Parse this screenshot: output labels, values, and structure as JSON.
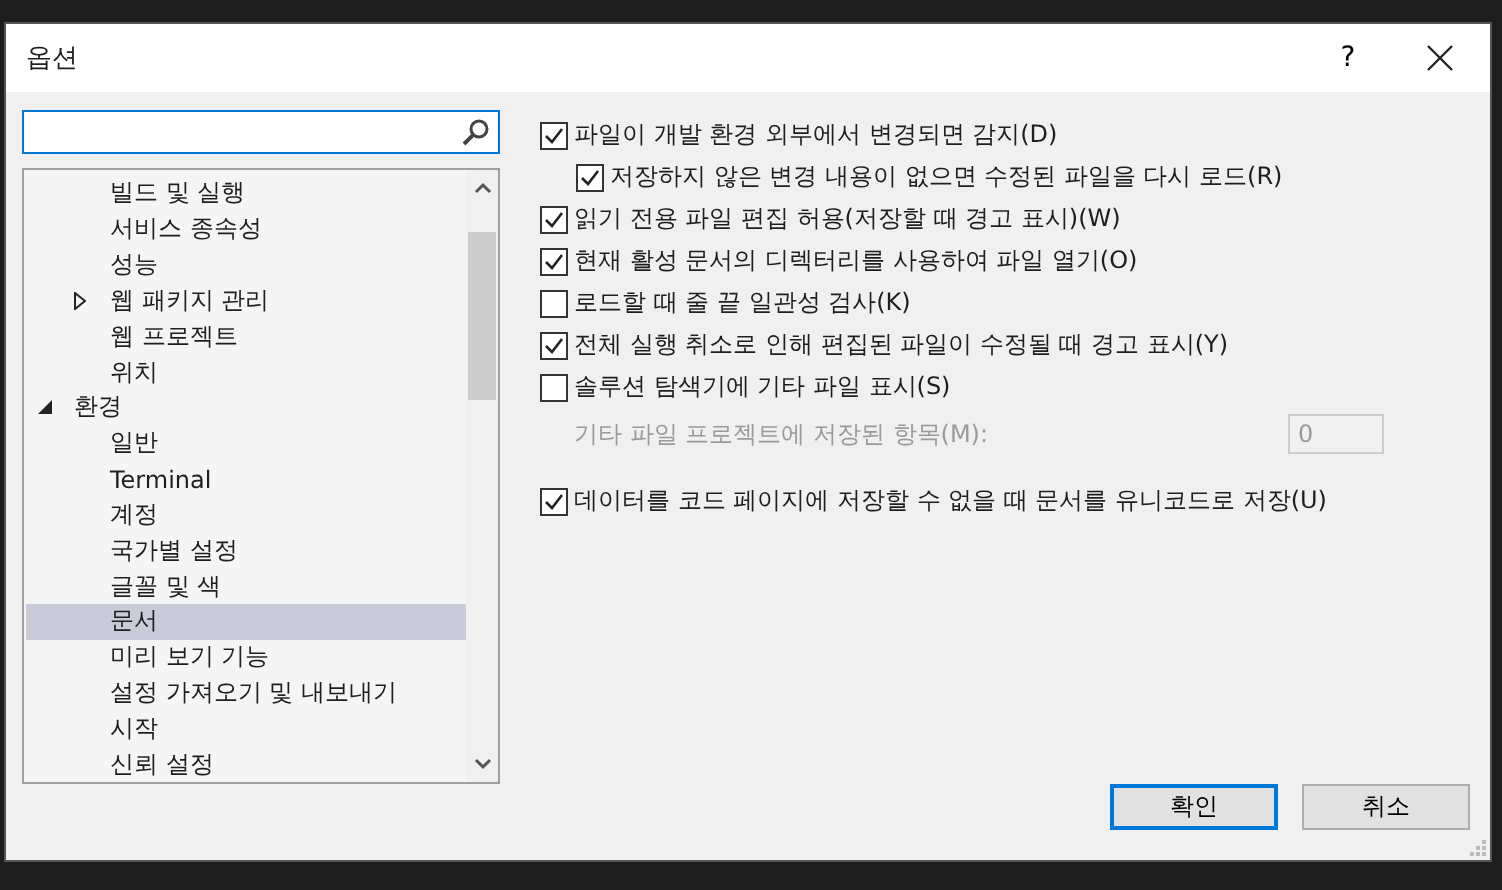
{
  "window": {
    "title": "옵션",
    "help": "?"
  },
  "tree": {
    "continued_items": [
      {
        "label": "빌드 및 실행",
        "selected": false
      },
      {
        "label": "서비스 종속성",
        "selected": false
      },
      {
        "label": "성능",
        "selected": false
      },
      {
        "label": "웹 패키지 관리",
        "selected": false,
        "expanded": false
      },
      {
        "label": "웹 프로젝트",
        "selected": false
      },
      {
        "label": "위치",
        "selected": false
      }
    ],
    "items": [
      {
        "label": "환경",
        "selected": false,
        "expanded": true,
        "children": [
          {
            "label": "일반",
            "selected": false
          },
          {
            "label": "Terminal",
            "selected": false
          },
          {
            "label": "계정",
            "selected": false
          },
          {
            "label": "국가별 설정",
            "selected": false
          },
          {
            "label": "글꼴 및 색",
            "selected": false
          },
          {
            "label": "문서",
            "selected": true
          },
          {
            "label": "미리 보기 기능",
            "selected": false
          },
          {
            "label": "설정 가져오기 및 내보내기",
            "selected": false
          },
          {
            "label": "시작",
            "selected": false
          },
          {
            "label": "신뢰 설정",
            "selected": false
          }
        ]
      }
    ]
  },
  "options": [
    {
      "kind": "checkbox",
      "label": "파일이 개발 환경 외부에서 변경되면 감지(D)",
      "checked": true
    },
    {
      "kind": "subcheckbox",
      "label": "저장하지 않은 변경 내용이 없으면 수정된 파일을 다시 로드(R)",
      "checked": true
    },
    {
      "kind": "checkbox",
      "label": "읽기 전용 파일 편집 허용(저장할 때 경고 표시)(W)",
      "checked": true
    },
    {
      "kind": "checkbox",
      "label": "현재 활성 문서의 디렉터리를 사용하여 파일 열기(O)",
      "checked": true
    },
    {
      "kind": "checkbox",
      "label": "로드할 때 줄 끝 일관성 검사(K)",
      "checked": false
    },
    {
      "kind": "checkbox",
      "label": "전체 실행 취소로 인해 편집된 파일이 수정될 때 경고 표시(Y)",
      "checked": true
    },
    {
      "kind": "checkbox",
      "label": "솔루션 탐색기에 기타 파일 표시(S)",
      "checked": false
    },
    {
      "kind": "number",
      "label": "기타 파일 프로젝트에 저장된 항목(M):",
      "value": "0",
      "disabled": true
    },
    {
      "kind": "checkbox",
      "label": "데이터를 코드 페이지에 저장할 수 없을 때 문서를 유니코드로 저장(U)",
      "checked": true
    }
  ],
  "buttons": [
    {
      "label": "확인",
      "focused": true
    },
    {
      "label": "취소",
      "focused": false
    }
  ]
}
